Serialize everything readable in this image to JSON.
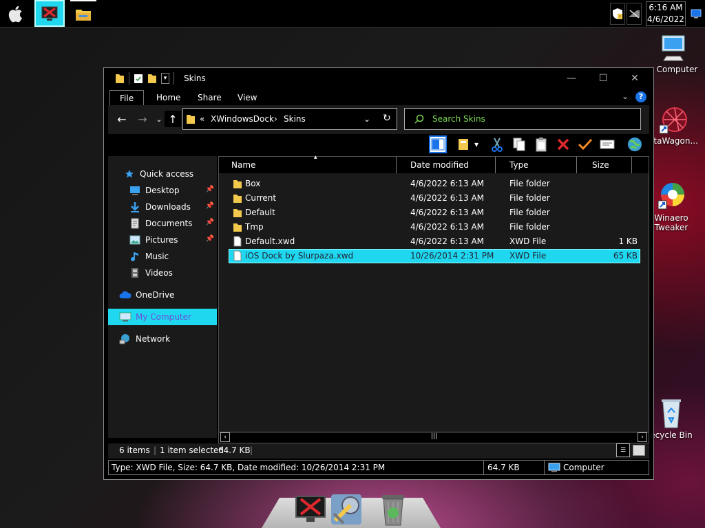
{
  "clock": {
    "time": "6:16 AM",
    "date": "4/6/2022"
  },
  "desktop_icons": [
    {
      "label": "y Computer"
    },
    {
      "label": "ataWagon..."
    },
    {
      "label": "Winaero\nTweaker"
    },
    {
      "label": "ecycle Bin"
    }
  ],
  "window": {
    "title": "Skins",
    "tabs": [
      "File",
      "Home",
      "Share",
      "View"
    ],
    "breadcrumb": {
      "overflow": "«",
      "parent": "XWindowsDock",
      "current": "Skins"
    },
    "search_placeholder": "Search Skins",
    "columns": [
      "Name",
      "Date modified",
      "Type",
      "Size"
    ],
    "nav": {
      "quick_access": "Quick access",
      "desktop": "Desktop",
      "downloads": "Downloads",
      "documents": "Documents",
      "pictures": "Pictures",
      "music": "Music",
      "videos": "Videos",
      "onedrive": "OneDrive",
      "my_computer": "My Computer",
      "network": "Network"
    },
    "files": [
      {
        "name": "Box",
        "date": "4/6/2022 6:13 AM",
        "type": "File folder",
        "size": ""
      },
      {
        "name": "Current",
        "date": "4/6/2022 6:13 AM",
        "type": "File folder",
        "size": ""
      },
      {
        "name": "Default",
        "date": "4/6/2022 6:13 AM",
        "type": "File folder",
        "size": ""
      },
      {
        "name": "Tmp",
        "date": "4/6/2022 6:13 AM",
        "type": "File folder",
        "size": ""
      },
      {
        "name": "Default.xwd",
        "date": "4/6/2022 6:13 AM",
        "type": "XWD File",
        "size": "1 KB"
      },
      {
        "name": "iOS Dock by Slurpaza.xwd",
        "date": "10/26/2014 2:31 PM",
        "type": "XWD File",
        "size": "65 KB"
      }
    ],
    "status": {
      "items": "6 items",
      "selected": "1 item selected",
      "size": "64.7 KB"
    },
    "info": {
      "details": "Type: XWD File, Size: 64.7 KB, Date modified: 10/26/2014 2:31 PM",
      "size": "64.7 KB",
      "location": "Computer"
    }
  },
  "colors": {
    "accent": "#1fd8f0",
    "search_text": "#7ed957",
    "selected_text": "#6b4fd6"
  }
}
